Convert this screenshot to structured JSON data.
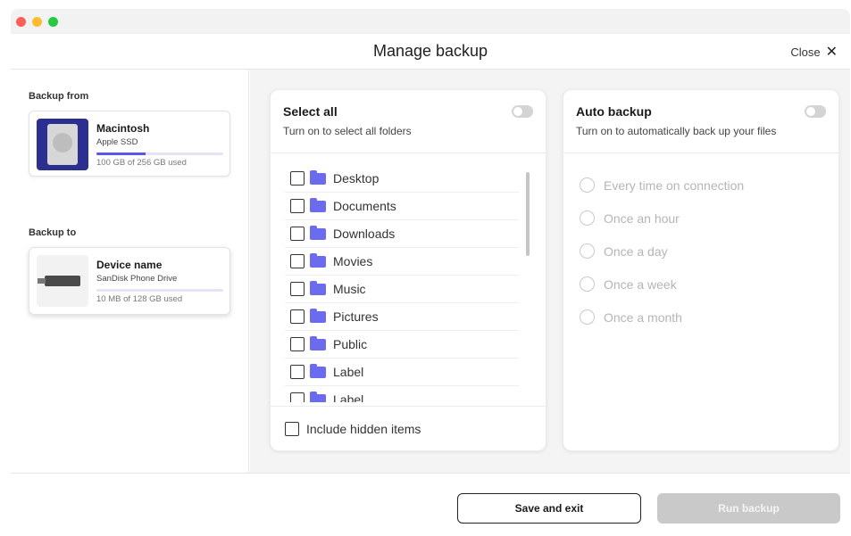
{
  "window": {
    "title": "Manage backup",
    "close_label": "Close"
  },
  "sidebar": {
    "backup_from_label": "Backup from",
    "backup_to_label": "Backup to",
    "source": {
      "name": "Macintosh",
      "type": "Apple SSD",
      "usage": "100 GB of 256 GB used",
      "fill_fraction": 0.39
    },
    "destination": {
      "name": "Device name",
      "type": "SanDisk Phone Drive",
      "usage": "10 MB of 128 GB used",
      "fill_fraction": 0.0
    }
  },
  "folders_panel": {
    "title": "Select all",
    "subtitle": "Turn on to select all folders",
    "toggle_on": false,
    "items": [
      {
        "label": "Desktop"
      },
      {
        "label": "Documents"
      },
      {
        "label": "Downloads"
      },
      {
        "label": "Movies"
      },
      {
        "label": "Music"
      },
      {
        "label": "Pictures"
      },
      {
        "label": "Public"
      },
      {
        "label": "Label"
      },
      {
        "label": "Label"
      }
    ],
    "hidden_items_label": "Include hidden items"
  },
  "auto_panel": {
    "title": "Auto backup",
    "subtitle": "Turn on to automatically back up your files",
    "toggle_on": false,
    "options": [
      {
        "label": "Every time on connection"
      },
      {
        "label": "Once an hour"
      },
      {
        "label": "Once a day"
      },
      {
        "label": "Once a week"
      },
      {
        "label": "Once a month"
      }
    ]
  },
  "footer": {
    "save_label": "Save and exit",
    "run_label": "Run backup"
  },
  "colors": {
    "accent": "#5a56e8",
    "folder": "#6b6bf0",
    "disabled_button": "#c9c9c9"
  }
}
